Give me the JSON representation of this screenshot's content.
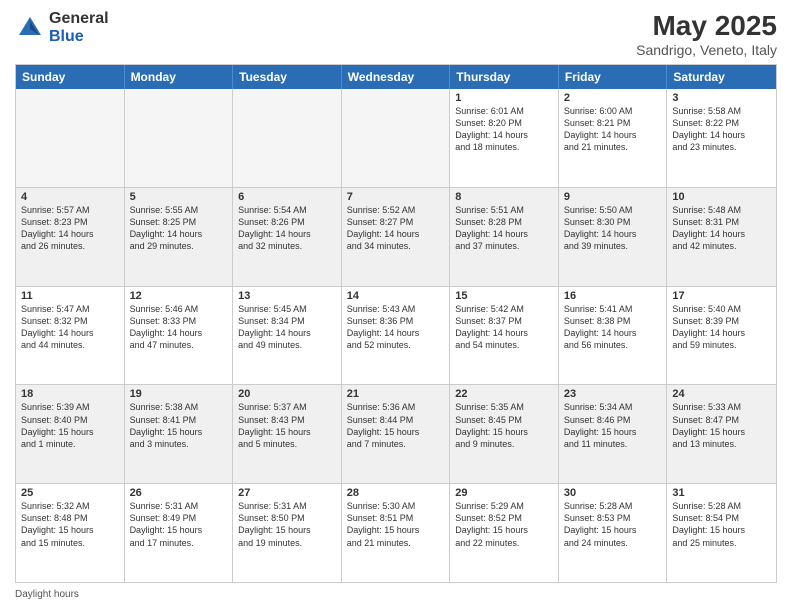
{
  "logo": {
    "general": "General",
    "blue": "Blue"
  },
  "title": "May 2025",
  "subtitle": "Sandrigo, Veneto, Italy",
  "header_days": [
    "Sunday",
    "Monday",
    "Tuesday",
    "Wednesday",
    "Thursday",
    "Friday",
    "Saturday"
  ],
  "footer": "Daylight hours",
  "weeks": [
    [
      {
        "day": "",
        "info": "",
        "empty": true
      },
      {
        "day": "",
        "info": "",
        "empty": true
      },
      {
        "day": "",
        "info": "",
        "empty": true
      },
      {
        "day": "",
        "info": "",
        "empty": true
      },
      {
        "day": "1",
        "info": "Sunrise: 6:01 AM\nSunset: 8:20 PM\nDaylight: 14 hours\nand 18 minutes."
      },
      {
        "day": "2",
        "info": "Sunrise: 6:00 AM\nSunset: 8:21 PM\nDaylight: 14 hours\nand 21 minutes."
      },
      {
        "day": "3",
        "info": "Sunrise: 5:58 AM\nSunset: 8:22 PM\nDaylight: 14 hours\nand 23 minutes."
      }
    ],
    [
      {
        "day": "4",
        "info": "Sunrise: 5:57 AM\nSunset: 8:23 PM\nDaylight: 14 hours\nand 26 minutes."
      },
      {
        "day": "5",
        "info": "Sunrise: 5:55 AM\nSunset: 8:25 PM\nDaylight: 14 hours\nand 29 minutes."
      },
      {
        "day": "6",
        "info": "Sunrise: 5:54 AM\nSunset: 8:26 PM\nDaylight: 14 hours\nand 32 minutes."
      },
      {
        "day": "7",
        "info": "Sunrise: 5:52 AM\nSunset: 8:27 PM\nDaylight: 14 hours\nand 34 minutes."
      },
      {
        "day": "8",
        "info": "Sunrise: 5:51 AM\nSunset: 8:28 PM\nDaylight: 14 hours\nand 37 minutes."
      },
      {
        "day": "9",
        "info": "Sunrise: 5:50 AM\nSunset: 8:30 PM\nDaylight: 14 hours\nand 39 minutes."
      },
      {
        "day": "10",
        "info": "Sunrise: 5:48 AM\nSunset: 8:31 PM\nDaylight: 14 hours\nand 42 minutes."
      }
    ],
    [
      {
        "day": "11",
        "info": "Sunrise: 5:47 AM\nSunset: 8:32 PM\nDaylight: 14 hours\nand 44 minutes."
      },
      {
        "day": "12",
        "info": "Sunrise: 5:46 AM\nSunset: 8:33 PM\nDaylight: 14 hours\nand 47 minutes."
      },
      {
        "day": "13",
        "info": "Sunrise: 5:45 AM\nSunset: 8:34 PM\nDaylight: 14 hours\nand 49 minutes."
      },
      {
        "day": "14",
        "info": "Sunrise: 5:43 AM\nSunset: 8:36 PM\nDaylight: 14 hours\nand 52 minutes."
      },
      {
        "day": "15",
        "info": "Sunrise: 5:42 AM\nSunset: 8:37 PM\nDaylight: 14 hours\nand 54 minutes."
      },
      {
        "day": "16",
        "info": "Sunrise: 5:41 AM\nSunset: 8:38 PM\nDaylight: 14 hours\nand 56 minutes."
      },
      {
        "day": "17",
        "info": "Sunrise: 5:40 AM\nSunset: 8:39 PM\nDaylight: 14 hours\nand 59 minutes."
      }
    ],
    [
      {
        "day": "18",
        "info": "Sunrise: 5:39 AM\nSunset: 8:40 PM\nDaylight: 15 hours\nand 1 minute."
      },
      {
        "day": "19",
        "info": "Sunrise: 5:38 AM\nSunset: 8:41 PM\nDaylight: 15 hours\nand 3 minutes."
      },
      {
        "day": "20",
        "info": "Sunrise: 5:37 AM\nSunset: 8:43 PM\nDaylight: 15 hours\nand 5 minutes."
      },
      {
        "day": "21",
        "info": "Sunrise: 5:36 AM\nSunset: 8:44 PM\nDaylight: 15 hours\nand 7 minutes."
      },
      {
        "day": "22",
        "info": "Sunrise: 5:35 AM\nSunset: 8:45 PM\nDaylight: 15 hours\nand 9 minutes."
      },
      {
        "day": "23",
        "info": "Sunrise: 5:34 AM\nSunset: 8:46 PM\nDaylight: 15 hours\nand 11 minutes."
      },
      {
        "day": "24",
        "info": "Sunrise: 5:33 AM\nSunset: 8:47 PM\nDaylight: 15 hours\nand 13 minutes."
      }
    ],
    [
      {
        "day": "25",
        "info": "Sunrise: 5:32 AM\nSunset: 8:48 PM\nDaylight: 15 hours\nand 15 minutes."
      },
      {
        "day": "26",
        "info": "Sunrise: 5:31 AM\nSunset: 8:49 PM\nDaylight: 15 hours\nand 17 minutes."
      },
      {
        "day": "27",
        "info": "Sunrise: 5:31 AM\nSunset: 8:50 PM\nDaylight: 15 hours\nand 19 minutes."
      },
      {
        "day": "28",
        "info": "Sunrise: 5:30 AM\nSunset: 8:51 PM\nDaylight: 15 hours\nand 21 minutes."
      },
      {
        "day": "29",
        "info": "Sunrise: 5:29 AM\nSunset: 8:52 PM\nDaylight: 15 hours\nand 22 minutes."
      },
      {
        "day": "30",
        "info": "Sunrise: 5:28 AM\nSunset: 8:53 PM\nDaylight: 15 hours\nand 24 minutes."
      },
      {
        "day": "31",
        "info": "Sunrise: 5:28 AM\nSunset: 8:54 PM\nDaylight: 15 hours\nand 25 minutes."
      }
    ]
  ]
}
